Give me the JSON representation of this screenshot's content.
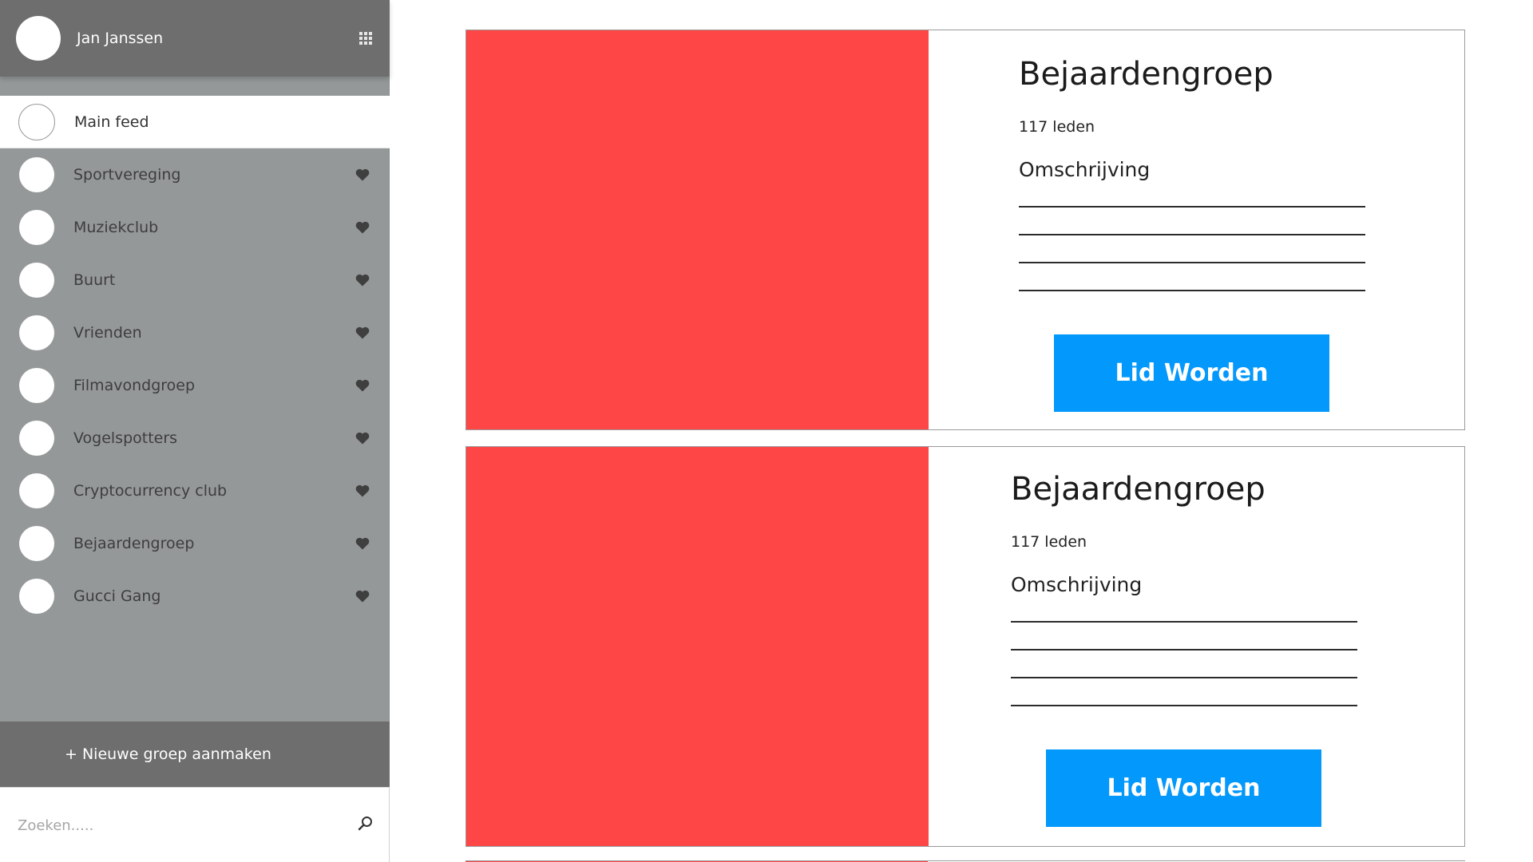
{
  "user": {
    "name": "Jan Janssen"
  },
  "sidebar": {
    "items": [
      {
        "label": "Main feed",
        "favorite": false
      },
      {
        "label": "Sportvereging",
        "favorite": true
      },
      {
        "label": "Muziekclub",
        "favorite": true
      },
      {
        "label": "Buurt",
        "favorite": true
      },
      {
        "label": "Vrienden",
        "favorite": true
      },
      {
        "label": "Filmavondgroep",
        "favorite": true
      },
      {
        "label": "Vogelspotters",
        "favorite": true
      },
      {
        "label": "Cryptocurrency club",
        "favorite": true
      },
      {
        "label": "Bejaardengroep",
        "favorite": true
      },
      {
        "label": "Gucci Gang",
        "favorite": true
      }
    ],
    "new_group_label": "+ Nieuwe groep aanmaken",
    "search_placeholder": "Zoeken.....",
    "heart_icon_color": "#3f3f3f"
  },
  "cards": [
    {
      "title": "Bejaardengroep",
      "members": "117 leden",
      "description_label": "Omschrijving",
      "description_lines": [
        "________________________________________",
        "________________________________________",
        "________________________________________",
        "________________________________________"
      ],
      "button_label": "Lid Worden"
    },
    {
      "title": "Bejaardengroep",
      "members": "117 leden",
      "description_label": "Omschrijving",
      "description_lines": [
        "________________________________________",
        "________________________________________",
        "________________________________________",
        "________________________________________"
      ],
      "button_label": "Lid Worden"
    }
  ],
  "colors": {
    "sidebar_bg": "#959899",
    "header_bg": "#6e6e6e",
    "card_image": "#fe4646",
    "button": "#0398fb"
  }
}
